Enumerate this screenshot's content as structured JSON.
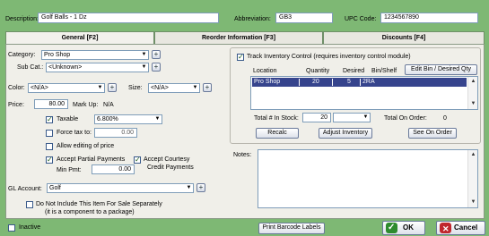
{
  "header": {
    "description_label": "Description:",
    "description_value": "Golf Balls - 1 Dz",
    "abbreviation_label": "Abbreviation:",
    "abbreviation_value": "GB3",
    "upc_label": "UPC Code:",
    "upc_value": "1234567890"
  },
  "tabs": [
    {
      "label": "General [F2]",
      "active": true
    },
    {
      "label": "Reorder Information [F3]",
      "active": false
    },
    {
      "label": "Discounts [F4]",
      "active": false
    }
  ],
  "general": {
    "category_label": "Category:",
    "category_value": "Pro Shop",
    "subcat_label": "Sub Cat.:",
    "subcat_value": "<Unknown>",
    "color_label": "Color:",
    "color_value": "<N/A>",
    "size_label": "Size:",
    "size_value": "<N/A>",
    "price_label": "Price:",
    "price_value": "80.00",
    "markup_label": "Mark Up:",
    "markup_value": "N/A",
    "taxable_label": "Taxable",
    "taxable_checked": true,
    "tax_rate_value": "6.800%",
    "force_tax_label": "Force tax to:",
    "force_tax_checked": false,
    "force_tax_value": "0.00",
    "allow_edit_label": "Allow editing of price",
    "allow_edit_checked": false,
    "partial_payments_label": "Accept Partial Payments",
    "partial_payments_checked": true,
    "min_pmt_label": "Min Pmt:",
    "min_pmt_value": "0.00",
    "courtesy_label_line1": "Accept Courtesy",
    "courtesy_label_line2": "Credit Payments",
    "courtesy_checked": true,
    "gl_account_label": "GL Account:",
    "gl_account_value": "Golf",
    "exclude_label_line1": "Do Not Include This Item For Sale Separately",
    "exclude_label_line2": "(it is a component to a package)",
    "exclude_checked": false
  },
  "inventory": {
    "track_label": "Track Inventory Control  (requires inventory control module)",
    "track_checked": true,
    "columns": [
      "Location",
      "Quantity",
      "Desired",
      "Bin/Shelf"
    ],
    "edit_bin_button": "Edit Bin / Desired Qty",
    "rows": [
      {
        "location": "Pro Shop",
        "quantity": "20",
        "desired": "5",
        "bin": "2RA"
      }
    ],
    "total_label": "Total # In Stock:",
    "total_value": "20",
    "total_on_order_label": "Total On Order:",
    "total_on_order_value": "0",
    "recalc_button": "Recalc",
    "adjust_button": "Adjust Inventory",
    "see_on_order_button": "See On Order"
  },
  "notes": {
    "label": "Notes:",
    "value": ""
  },
  "footer": {
    "inactive_label": "Inactive",
    "inactive_checked": false,
    "print_barcode_button": "Print Barcode Labels",
    "ok_button": "OK",
    "cancel_button": "Cancel"
  },
  "colors": {
    "background": "#7eb874",
    "panel": "#f0efe9",
    "selection": "#36448d",
    "ok_icon": "#2e8b2e",
    "cancel_icon": "#c0272d"
  },
  "icons": [
    "chevron-down-icon",
    "plus-icon",
    "checkmark-icon",
    "close-icon",
    "scroll-up-icon",
    "scroll-down-icon"
  ]
}
